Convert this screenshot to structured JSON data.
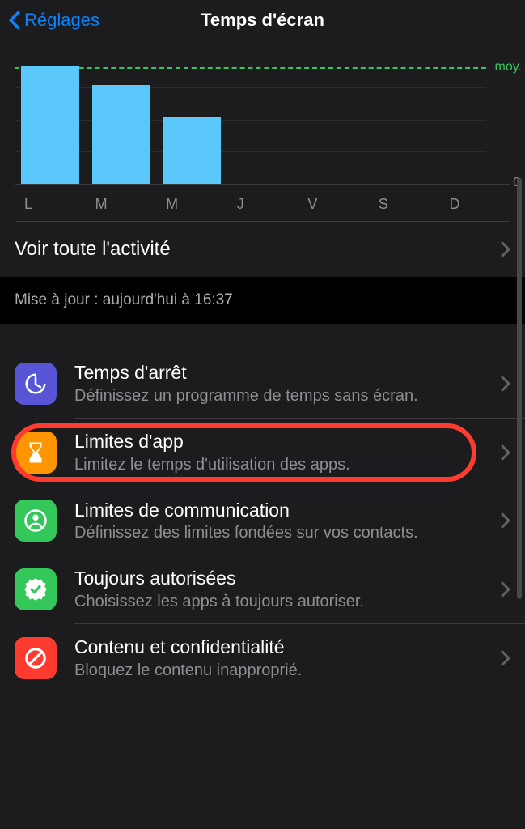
{
  "nav": {
    "back": "Réglages",
    "title": "Temps d'écran"
  },
  "chart_data": {
    "type": "bar",
    "categories": [
      "L",
      "M",
      "M",
      "J",
      "V",
      "S",
      "D"
    ],
    "values": [
      130,
      110,
      75,
      0,
      0,
      0,
      0
    ],
    "avg_label": "moy.",
    "zero_label": "0",
    "avg": 120
  },
  "activity": {
    "label": "Voir toute l'activité"
  },
  "update": {
    "text": "Mise à jour : aujourd'hui à 16:37"
  },
  "items": [
    {
      "title": "Temps d'arrêt",
      "sub": "Définissez un programme de temps sans écran."
    },
    {
      "title": "Limites d'app",
      "sub": "Limitez le temps d'utilisation des apps."
    },
    {
      "title": "Limites de communication",
      "sub": "Définissez des limites fondées sur vos contacts."
    },
    {
      "title": "Toujours autorisées",
      "sub": "Choisissez les apps à toujours autoriser."
    },
    {
      "title": "Contenu et confidentialité",
      "sub": "Bloquez le contenu inapproprié."
    }
  ]
}
